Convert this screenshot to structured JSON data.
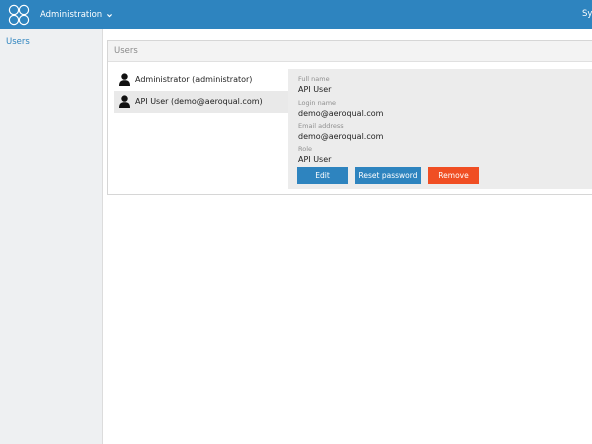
{
  "topbar": {
    "menu_label": "Administration",
    "system_label": "Sy",
    "colors": {
      "bar": "#2e84bf"
    }
  },
  "sidebar": {
    "items": [
      {
        "label": "Users"
      }
    ]
  },
  "panel": {
    "title": "Users",
    "users": [
      {
        "name": "Administrator (administrator)",
        "selected": false
      },
      {
        "name": "API User (demo@aeroqual.com)",
        "selected": true
      }
    ],
    "details": {
      "full_name_label": "Full name",
      "full_name": "API User",
      "login_name_label": "Login name",
      "login_name": "demo@aeroqual.com",
      "email_label": "Email address",
      "email": "demo@aeroqual.com",
      "role_label": "Role",
      "role": "API User"
    },
    "buttons": {
      "edit": "Edit",
      "reset": "Reset password",
      "remove": "Remove"
    }
  }
}
